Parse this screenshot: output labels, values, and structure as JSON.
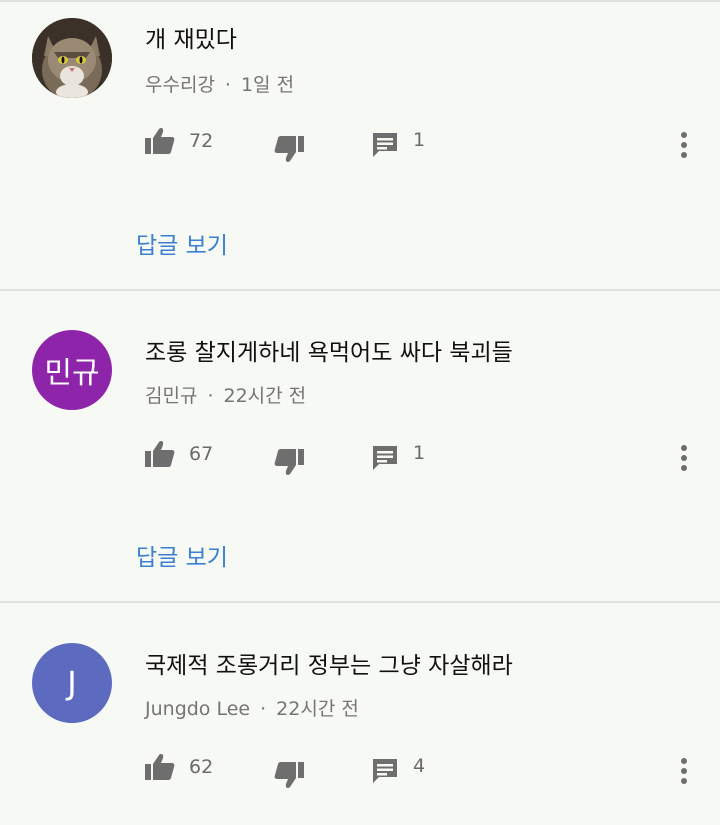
{
  "colors": {
    "background": "#f7f9f4",
    "link": "#3b7fd0",
    "avatar_purple": "#8e24aa",
    "avatar_blue": "#5c6bc0"
  },
  "comments": [
    {
      "avatar_type": "photo-cat",
      "avatar_text": "",
      "text": "개 재밌다",
      "author": "우수리강",
      "separator": "·",
      "time": "1일 전",
      "likes": "72",
      "replies_count": "1",
      "view_replies": "답글 보기"
    },
    {
      "avatar_type": "initials",
      "avatar_text": "민규",
      "text": "조롱 찰지게하네 욕먹어도 싸다 북괴들",
      "author": "김민규",
      "separator": "·",
      "time": "22시간 전",
      "likes": "67",
      "replies_count": "1",
      "view_replies": "답글 보기"
    },
    {
      "avatar_type": "initials",
      "avatar_text": "J",
      "text": "국제적 조롱거리 정부는 그냥 자살해라",
      "author": "Jungdo Lee",
      "separator": "·",
      "time": "22시간 전",
      "likes": "62",
      "replies_count": "4"
    }
  ],
  "icons": {
    "like": "thumbs-up-icon",
    "dislike": "thumbs-down-icon",
    "reply": "comment-icon",
    "menu": "more-vert-icon"
  }
}
